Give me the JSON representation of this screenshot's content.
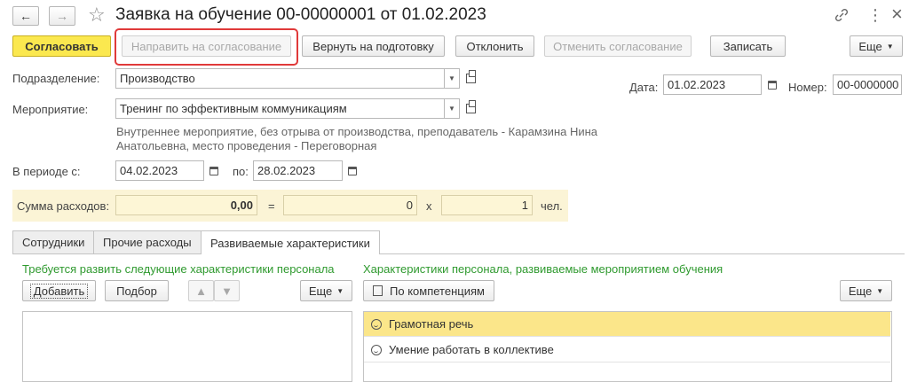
{
  "window": {
    "title": "Заявка на обучение 00-00000001 от 01.02.2023",
    "nav_back": "←",
    "nav_forward": "→",
    "star": "☆",
    "more_icon": "⋮",
    "close_icon": "×"
  },
  "toolbar": {
    "approve": "Согласовать",
    "send_for_approval": "Направить на согласование",
    "return_to_prep": "Вернуть на подготовку",
    "reject": "Отклонить",
    "cancel_approval": "Отменить согласование",
    "save": "Записать",
    "more": "Еще"
  },
  "form": {
    "department_label": "Подразделение:",
    "department_value": "Производство",
    "event_label": "Мероприятие:",
    "event_value": "Тренинг по эффективным коммуникациям",
    "event_description_line1": "Внутреннее мероприятие, без отрыва от производства, преподаватель - Карамзина Нина",
    "event_description_line2": "Анатольевна, место проведения - Переговорная",
    "period_label": "В периоде с:",
    "period_from": "04.02.2023",
    "period_to_label": "по:",
    "period_to": "28.02.2023",
    "date_label": "Дата:",
    "date_value": "01.02.2023",
    "number_label": "Номер:",
    "number_value": "00-0000000"
  },
  "expenses": {
    "label": "Сумма расходов:",
    "total": "0,00",
    "equals": "=",
    "per_person": "0",
    "times": "x",
    "count": "1",
    "unit": "чел."
  },
  "tabs": [
    {
      "label": "Сотрудники"
    },
    {
      "label": "Прочие расходы"
    },
    {
      "label": "Развиваемые характеристики"
    }
  ],
  "left_panel": {
    "heading": "Требуется развить следующие характеристики персонала",
    "add": "Добавить",
    "pick": "Подбор",
    "more": "Еще"
  },
  "right_panel": {
    "heading": "Характеристики персонала, развиваемые мероприятием обучения",
    "by_competencies": "По компетенциям",
    "more": "Еще",
    "items": [
      {
        "label": "Грамотная речь"
      },
      {
        "label": "Умение работать в коллективе"
      }
    ]
  },
  "colors": {
    "primary_button": "#fbe84f",
    "highlight_border": "#e03a3a",
    "green_heading": "#2f9a2f",
    "selected_row": "#fbe68a"
  }
}
